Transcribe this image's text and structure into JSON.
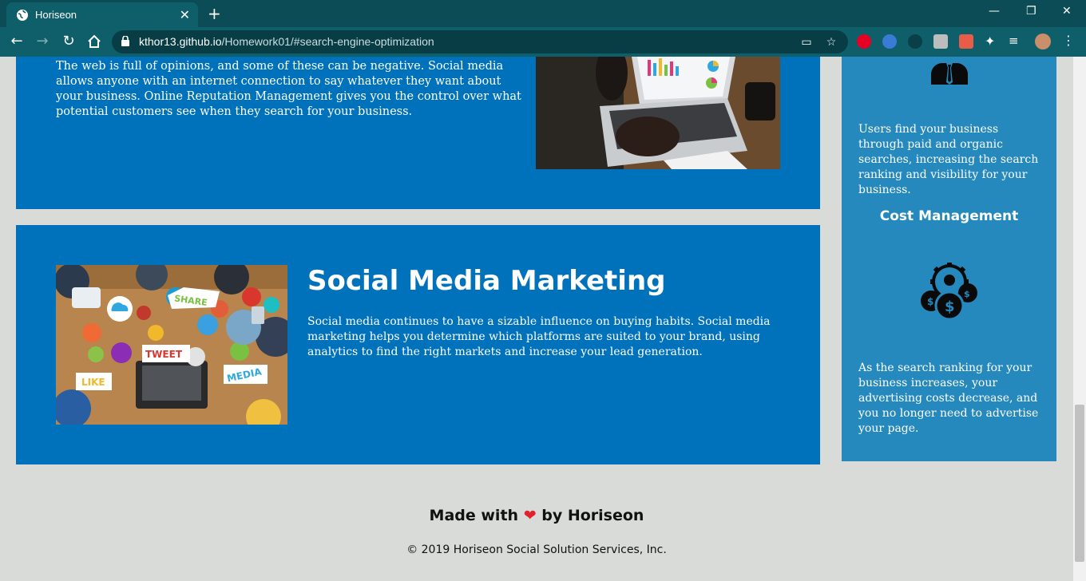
{
  "browser": {
    "tab_title": "Horiseon",
    "tab_close": "✕",
    "new_tab": "+",
    "url_host": "kthor13.github.io",
    "url_path": "/Homework01/#search-engine-optimization",
    "window_minimize": "—",
    "window_restore": "❐",
    "window_close": "✕"
  },
  "sections": {
    "reputation": {
      "text": "The web is full of opinions, and some of these can be negative. Social media allows anyone with an internet connection to say whatever they want about your business. Online Reputation Management gives you the control over what potential customers see when they search for your business."
    },
    "social": {
      "heading": "Social Media Marketing",
      "text": "Social media continues to have a sizable influence on buying habits. Social media marketing helps you determine which platforms are suited to your brand, using analytics to find the right markets and increase your lead generation."
    }
  },
  "aside": {
    "lead_text": "Users find your business through paid and organic searches, increasing the search ranking and visibility for your business.",
    "cost_heading": "Cost Management",
    "cost_text": "As the search ranking for your business increases, your advertising costs decrease, and you no longer need to advertise your page."
  },
  "footer": {
    "made_prefix": "Made with",
    "heart": "❤",
    "made_suffix": "by Horiseon",
    "copyright": "© 2019 Horiseon Social Solution Services, Inc."
  },
  "colors": {
    "chrome_dark": "#0c4c56",
    "chrome_tab": "#0f5f6b",
    "card_blue": "#0072bb",
    "aside_blue": "#2589bd",
    "page_bg": "#d9dbd8",
    "heart": "#e3212c"
  }
}
